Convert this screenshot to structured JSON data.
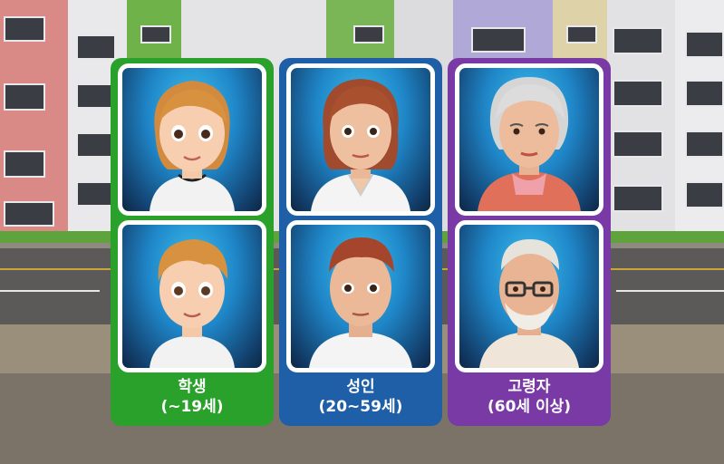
{
  "categories": [
    {
      "name": "학생",
      "range": "(~19세)",
      "color": "#2aa12a"
    },
    {
      "name": "성인",
      "range": "(20~59세)",
      "color": "#1e5fa8"
    },
    {
      "name": "고령자",
      "range": "(60세 이상)",
      "color": "#7a3aa6"
    }
  ]
}
